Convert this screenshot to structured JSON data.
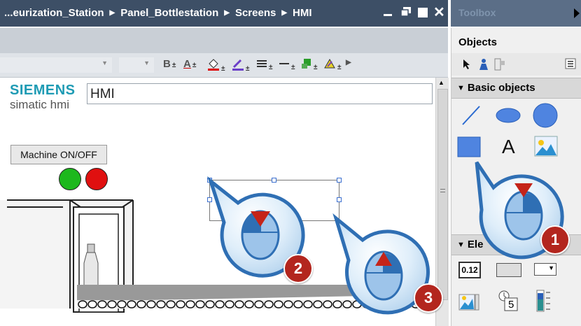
{
  "titlebar": {
    "breadcrumb": [
      "...eurization_Station",
      "Panel_Bottlestation",
      "Screens",
      "HMI"
    ]
  },
  "toolbox": {
    "title": "Toolbox",
    "objects_label": "Objects",
    "sections": {
      "basic_objects": "Basic objects",
      "elements": "Ele"
    },
    "elements_numeric_text": "0.12",
    "elements_clock_text": "5"
  },
  "toolbar": {
    "bold_label": "B",
    "underline_label": "A"
  },
  "canvas": {
    "logo_text": "SIEMENS",
    "logo_subtext": "simatic hmi",
    "title_field_value": "HMI",
    "machine_button_label": "Machine ON/OFF",
    "text_tool_label": "A"
  },
  "callouts": [
    "1",
    "2",
    "3"
  ],
  "colors": {
    "titlebar_bg": "#3d4f66",
    "callout_blue": "#2f6fb4",
    "badge_red": "#b3261e",
    "lamp_green": "#1db81d",
    "lamp_red": "#e01010",
    "logo_teal": "#1e9bb4"
  }
}
